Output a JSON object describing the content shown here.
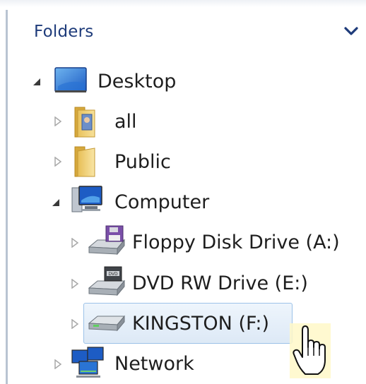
{
  "pane": {
    "title": "Folders",
    "collapse_icon": "chevron-down-icon"
  },
  "tree": {
    "desktop": {
      "label": "Desktop",
      "icon": "desktop-icon",
      "expanded": true
    },
    "all": {
      "label": "all",
      "icon": "user-folder-icon",
      "expanded": false
    },
    "public": {
      "label": "Public",
      "icon": "folder-icon",
      "expanded": false
    },
    "computer": {
      "label": "Computer",
      "icon": "computer-icon",
      "expanded": true
    },
    "floppy": {
      "label": "Floppy Disk Drive (A:)",
      "icon": "floppy-drive-icon",
      "expanded": false
    },
    "dvd": {
      "label": "DVD RW Drive (E:)",
      "icon": "dvd-drive-icon",
      "expanded": false
    },
    "kingston": {
      "label": "KINGSTON (F:)",
      "icon": "usb-drive-icon",
      "expanded": false,
      "selected": true
    },
    "network": {
      "label": "Network",
      "icon": "network-icon",
      "expanded": false
    }
  },
  "colors": {
    "title": "#1e3b7a",
    "selection_border": "#9cc2e8",
    "selection_fill": "#dde9f6"
  },
  "cursor": "hand-pointer-icon"
}
